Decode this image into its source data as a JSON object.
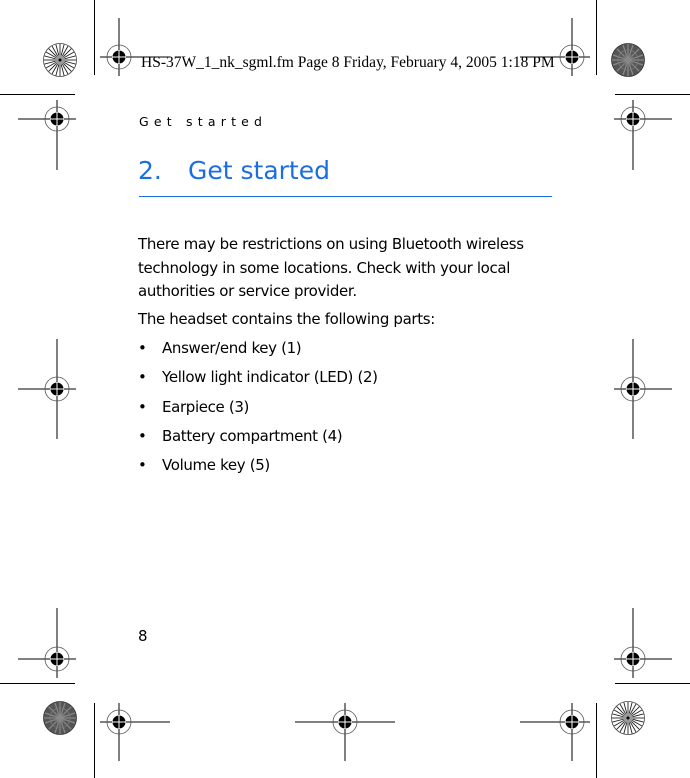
{
  "print_header": {
    "file_info": "HS-37W_1_nk_sgml.fm  Page 8  Friday, February 4, 2005  1:18 PM"
  },
  "running_head": "Get started",
  "chapter": {
    "number": "2.",
    "title": "Get started",
    "accent_color": "#1a6fe0"
  },
  "paragraphs": [
    "There may be restrictions on using Bluetooth wireless technology in some locations. Check with your local authorities or service provider.",
    "The headset contains the following parts:"
  ],
  "bullet_symbol": "•",
  "parts_list": [
    "Answer/end key (1)",
    "Yellow light indicator (LED) (2)",
    "Earpiece (3)",
    "Battery compartment (4)",
    "Volume key (5)"
  ],
  "page_number": "8",
  "print_marks": {
    "registration_mark_icon": "crosshair-target",
    "color_bar_icons": [
      "starburst-light",
      "starburst-dark"
    ]
  }
}
